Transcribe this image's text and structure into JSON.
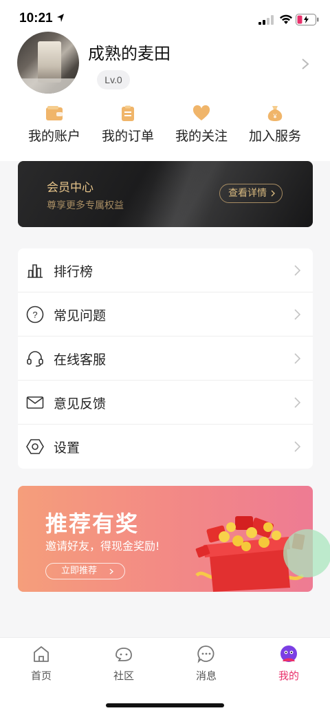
{
  "status_bar": {
    "time": "10:21"
  },
  "profile": {
    "name": "成熟的麦田",
    "level": "Lv.0"
  },
  "quick_actions": [
    {
      "label": "我的账户",
      "icon": "wallet-icon"
    },
    {
      "label": "我的订单",
      "icon": "order-icon"
    },
    {
      "label": "我的关注",
      "icon": "heart-icon"
    },
    {
      "label": "加入服务",
      "icon": "money-bag-icon"
    }
  ],
  "member_card": {
    "title": "会员中心",
    "subtitle": "尊享更多专属权益",
    "button_label": "查看详情"
  },
  "menu": [
    {
      "label": "排行榜",
      "icon": "ranking-icon"
    },
    {
      "label": "常见问题",
      "icon": "question-icon"
    },
    {
      "label": "在线客服",
      "icon": "headset-icon"
    },
    {
      "label": "意见反馈",
      "icon": "mail-icon"
    },
    {
      "label": "设置",
      "icon": "settings-icon"
    }
  ],
  "referral": {
    "title": "推荐有奖",
    "subtitle": "邀请好友，得现金奖励!",
    "button_label": "立即推荐"
  },
  "tabs": [
    {
      "label": "首页",
      "icon": "home-icon"
    },
    {
      "label": "社区",
      "icon": "community-icon"
    },
    {
      "label": "消息",
      "icon": "message-icon"
    },
    {
      "label": "我的",
      "icon": "profile-icon",
      "active": true
    }
  ],
  "colors": {
    "accent": "#e8306b",
    "gold": "#e6c48a",
    "quick_icon": "#f0b56a"
  }
}
